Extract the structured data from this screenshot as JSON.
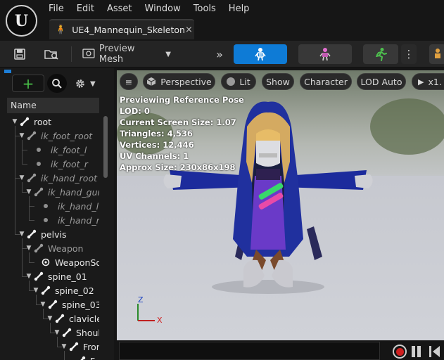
{
  "app": {
    "logo_text": "U"
  },
  "menu": [
    "File",
    "Edit",
    "Asset",
    "Window",
    "Tools",
    "Help"
  ],
  "document_tab": {
    "title": "UE4_Mannequin_Skeleton",
    "close": "×"
  },
  "toolbar": {
    "preview_mesh_label": "Preview Mesh",
    "modes": [
      "skeleton",
      "mesh",
      "animation",
      "physics"
    ],
    "accent_color": "#0e7bd6"
  },
  "skeleton_tree": {
    "column_header": "Name",
    "rows": [
      {
        "label": "root",
        "style": "normal",
        "kind": "bone",
        "depth": 0,
        "expander": true
      },
      {
        "label": "ik_foot_root",
        "style": "dim",
        "kind": "bone",
        "depth": 1,
        "expander": true
      },
      {
        "label": "ik_foot_l",
        "style": "dim",
        "kind": "dot",
        "depth": 2,
        "expander": false
      },
      {
        "label": "ik_foot_r",
        "style": "dim",
        "kind": "dot",
        "depth": 2,
        "expander": false
      },
      {
        "label": "ik_hand_root",
        "style": "dim",
        "kind": "bone",
        "depth": 1,
        "expander": true
      },
      {
        "label": "ik_hand_gun",
        "style": "dim",
        "kind": "bone",
        "depth": 2,
        "expander": true
      },
      {
        "label": "ik_hand_l",
        "style": "dim",
        "kind": "dot",
        "depth": 3,
        "expander": false
      },
      {
        "label": "ik_hand_r",
        "style": "dim",
        "kind": "dot",
        "depth": 3,
        "expander": false
      },
      {
        "label": "pelvis",
        "style": "normal",
        "kind": "bone",
        "depth": 1,
        "expander": true
      },
      {
        "label": "Weapon",
        "style": "dim-plain",
        "kind": "bone",
        "depth": 2,
        "expander": true
      },
      {
        "label": "WeaponSocket",
        "style": "socket",
        "kind": "socket",
        "depth": 3,
        "expander": false
      },
      {
        "label": "spine_01",
        "style": "normal",
        "kind": "bone",
        "depth": 2,
        "expander": true
      },
      {
        "label": "spine_02",
        "style": "normal",
        "kind": "bone",
        "depth": 3,
        "expander": true
      },
      {
        "label": "spine_03",
        "style": "normal",
        "kind": "bone",
        "depth": 4,
        "expander": true
      },
      {
        "label": "clavicle_l",
        "style": "normal",
        "kind": "bone",
        "depth": 5,
        "expander": true
      },
      {
        "label": "Shoulder",
        "style": "normal",
        "kind": "bone",
        "depth": 6,
        "expander": true
      },
      {
        "label": "Front",
        "style": "normal",
        "kind": "bone",
        "depth": 7,
        "expander": true
      },
      {
        "label": "F",
        "style": "normal",
        "kind": "bone",
        "depth": 8,
        "expander": false
      }
    ]
  },
  "viewport": {
    "buttons": {
      "perspective": "Perspective",
      "lit": "Lit",
      "show": "Show",
      "character": "Character",
      "lod": "LOD Auto",
      "speed": "x1."
    },
    "stats": [
      "Previewing Reference Pose",
      "LOD: 0",
      "Current Screen Size: 1.07",
      "Triangles: 4,536",
      "Vertices: 12,446",
      "UV Channels: 1",
      "Approx Size: 230x86x198"
    ],
    "gizmo": {
      "z": "Z",
      "x": "X"
    }
  }
}
